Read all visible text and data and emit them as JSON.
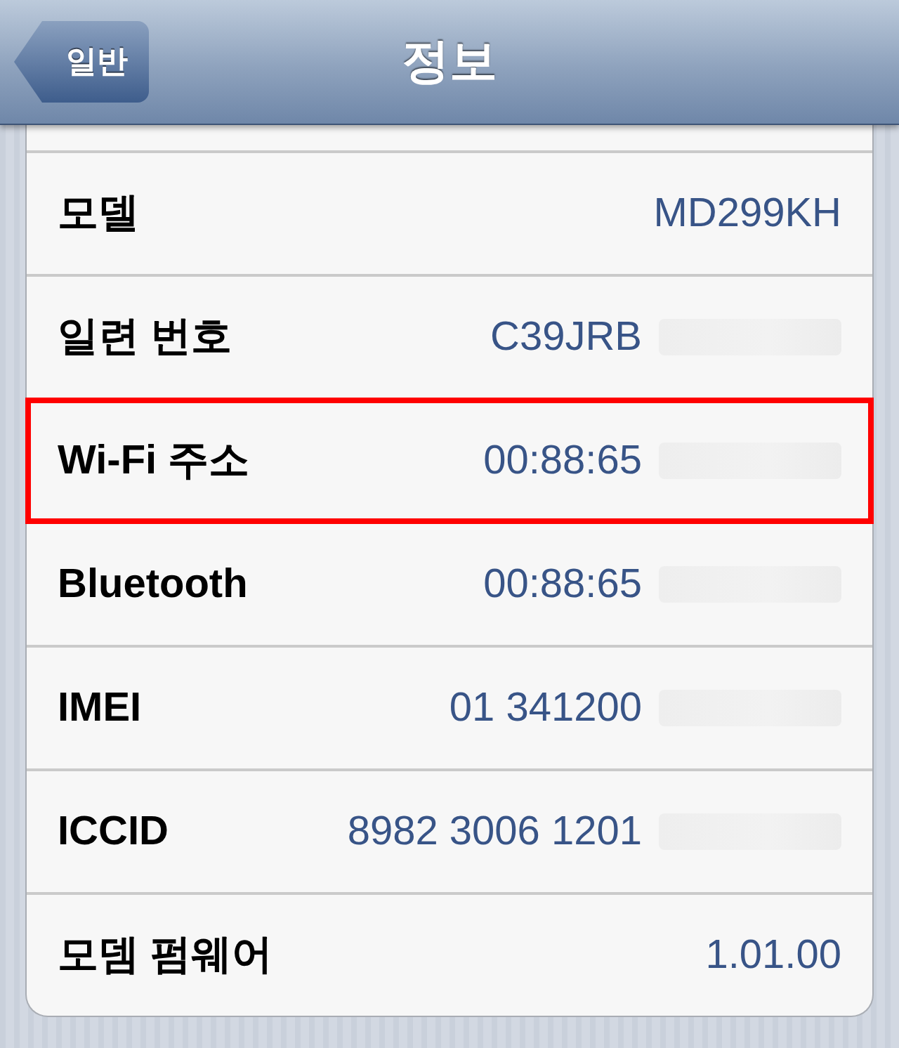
{
  "nav_bar": {
    "back_button": "일반",
    "title": "정보"
  },
  "rows": [
    {
      "label": "모델",
      "value": "MD299KH",
      "masked": false,
      "highlighted": false
    },
    {
      "label": "일련 번호",
      "value": "C39JRB",
      "masked": true,
      "highlighted": false
    },
    {
      "label": "Wi-Fi 주소",
      "value": "00:88:65",
      "masked": true,
      "highlighted": true
    },
    {
      "label": "Bluetooth",
      "value": "00:88:65",
      "masked": true,
      "highlighted": false
    },
    {
      "label": "IMEI",
      "value": "01 341200",
      "masked": true,
      "highlighted": false
    },
    {
      "label": "ICCID",
      "value": "8982 3006 1201",
      "masked": true,
      "highlighted": false
    },
    {
      "label": "모뎀 펌웨어",
      "value": "1.01.00",
      "masked": false,
      "highlighted": false
    }
  ]
}
